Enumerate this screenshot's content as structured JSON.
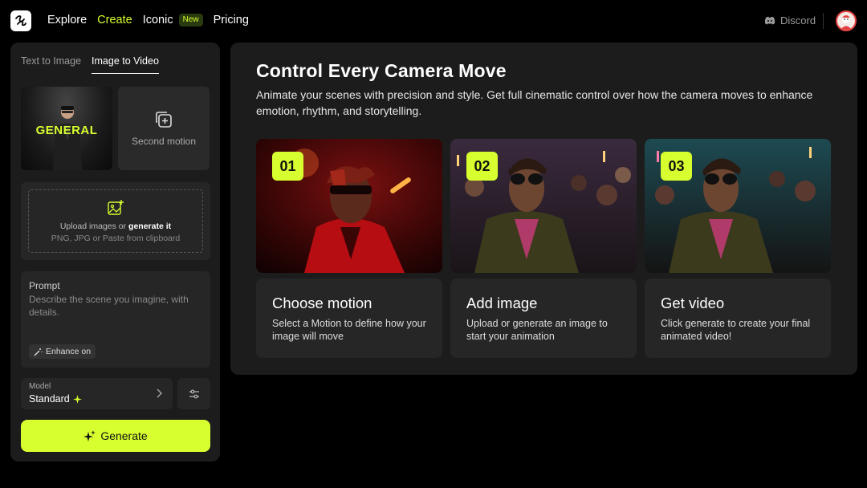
{
  "nav": {
    "items": [
      {
        "label": "Explore"
      },
      {
        "label": "Create"
      },
      {
        "label": "Iconic"
      },
      {
        "label": "Pricing"
      }
    ],
    "new_badge": "New",
    "discord_label": "Discord"
  },
  "left_panel": {
    "tabs": [
      {
        "label": "Text to Image"
      },
      {
        "label": "Image to Video"
      }
    ],
    "thumbnail_text": "GENERAL",
    "second_motion_label": "Second motion",
    "upload": {
      "line1_prefix": "Upload images or ",
      "line1_link": "generate it",
      "line2": "PNG, JPG or Paste from clipboard"
    },
    "prompt": {
      "label": "Prompt",
      "placeholder": "Describe the scene you imagine, with details.",
      "enhance_label": "Enhance on"
    },
    "model": {
      "label": "Model",
      "value": "Standard"
    },
    "generate_label": "Generate"
  },
  "main": {
    "title": "Control Every Camera Move",
    "description": "Animate your scenes with precision and style. Get full cinematic control over how the camera moves to enhance emotion, rhythm, and storytelling.",
    "steps": [
      {
        "num": "01",
        "title": "Choose motion",
        "desc": "Select a Motion to define how your image will move"
      },
      {
        "num": "02",
        "title": "Add image",
        "desc": "Upload or generate an image to start your animation"
      },
      {
        "num": "03",
        "title": "Get video",
        "desc": "Click generate to create your final animated video!"
      }
    ]
  },
  "colors": {
    "accent": "#d7ff2f",
    "panel": "#1c1c1c",
    "card": "#262626",
    "background": "#000000"
  }
}
